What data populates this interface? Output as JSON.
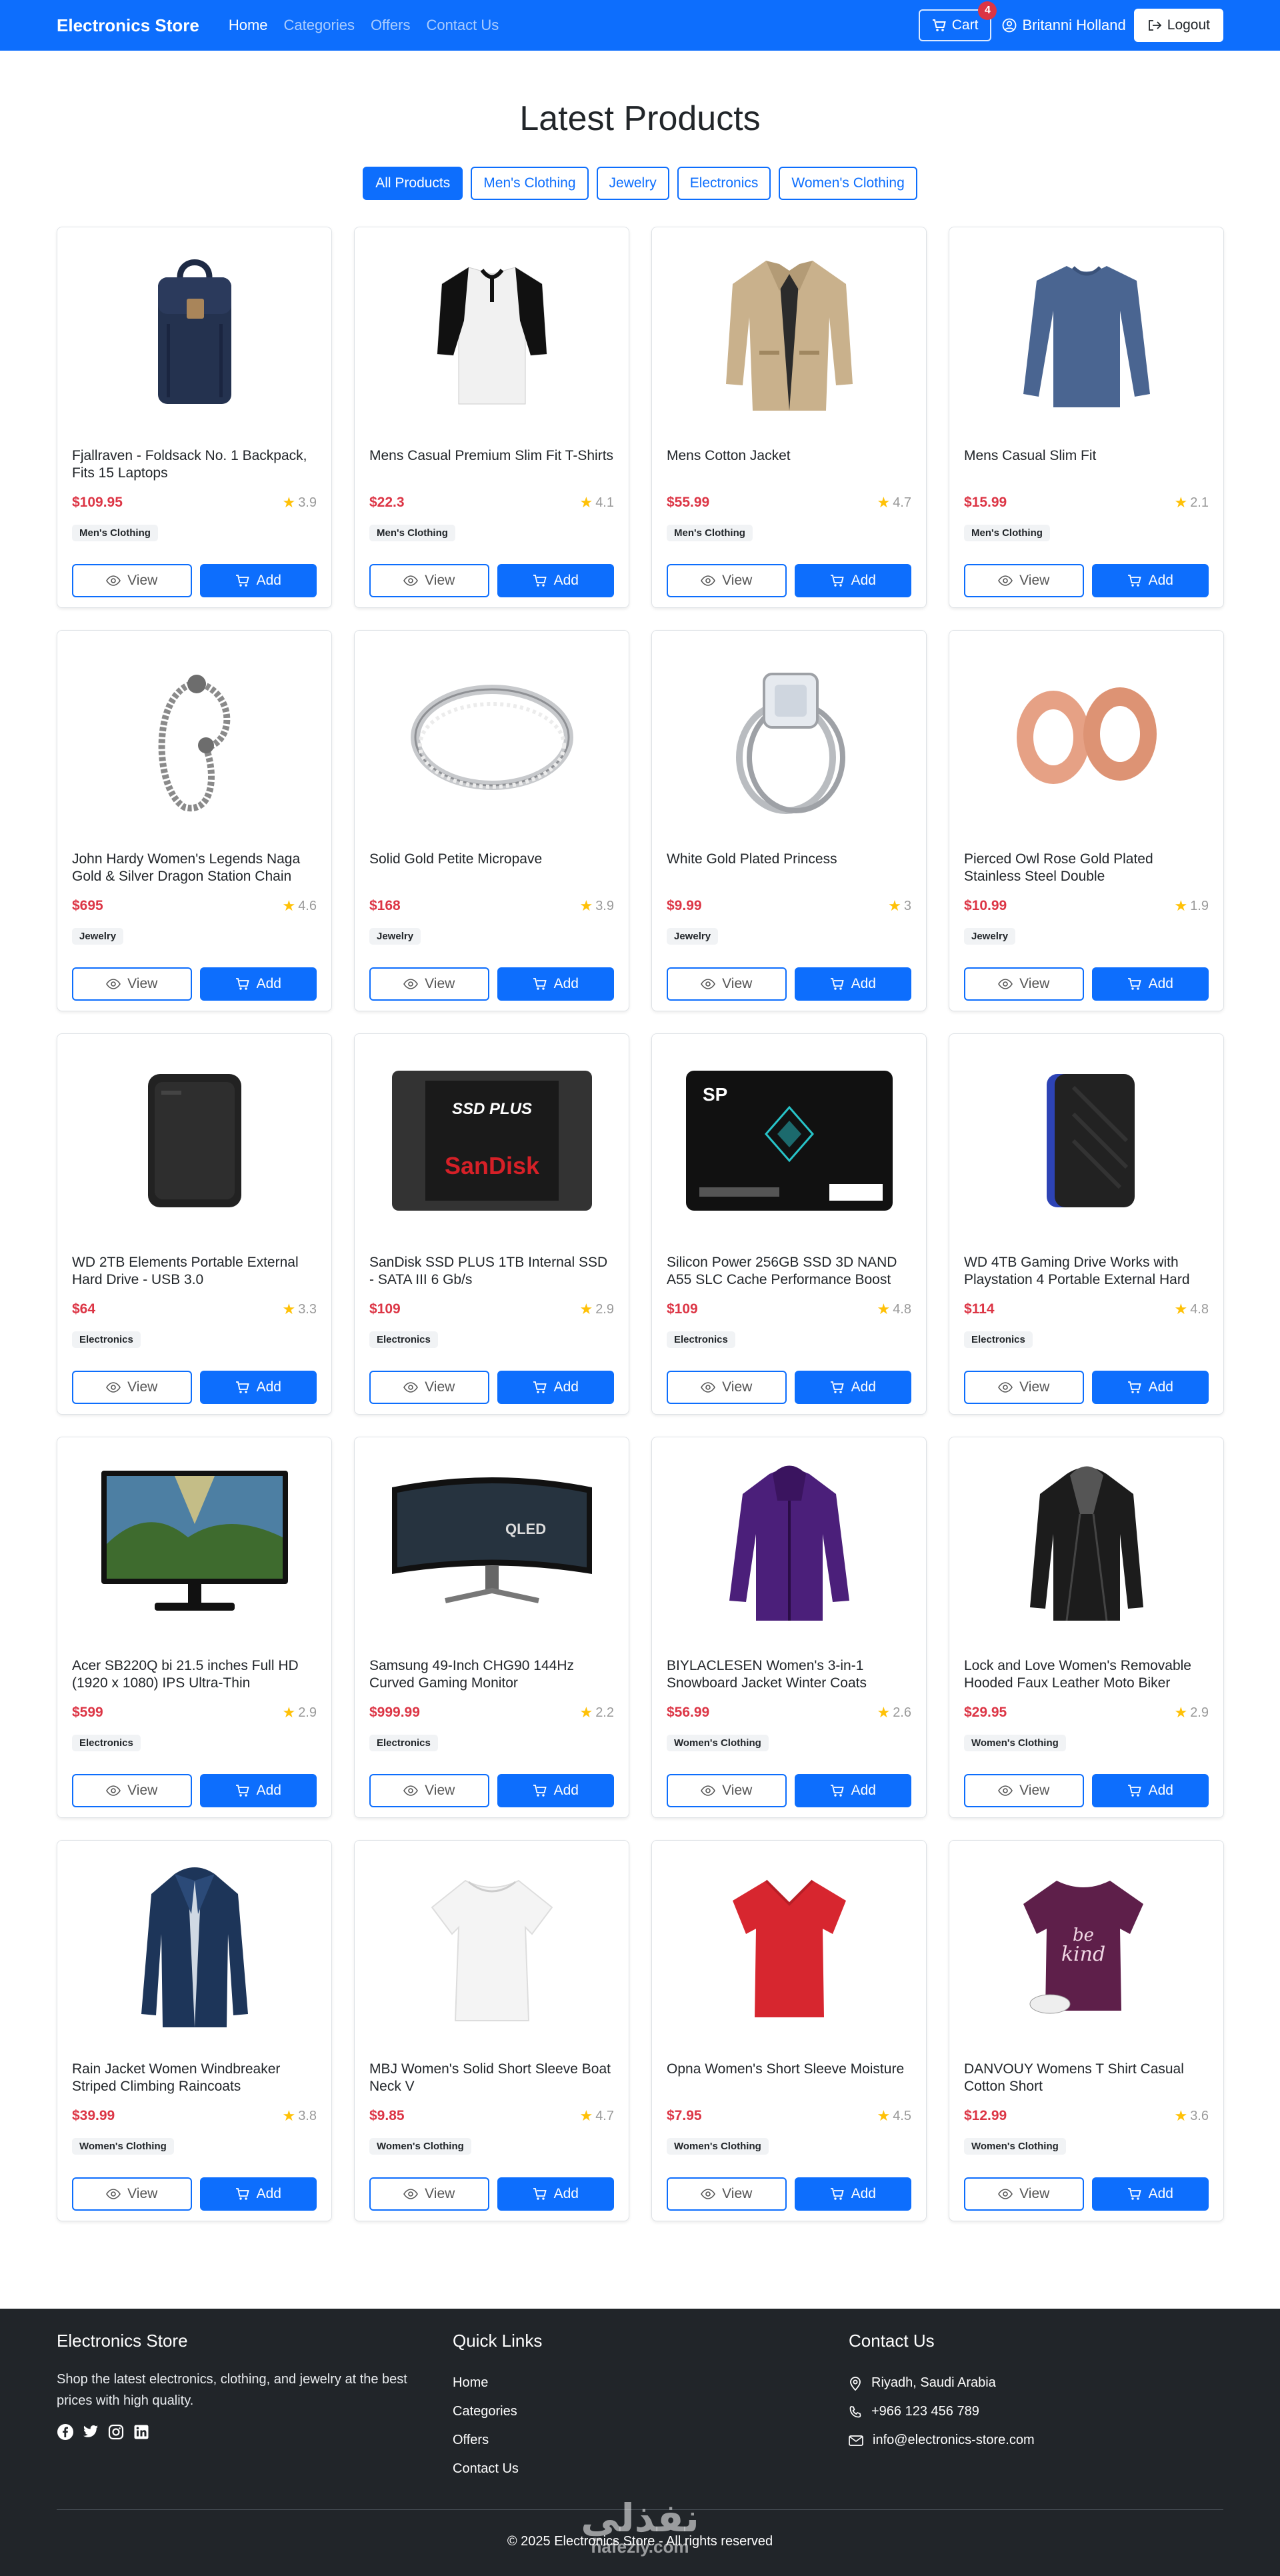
{
  "nav": {
    "brand": "Electronics Store",
    "links": [
      "Home",
      "Categories",
      "Offers",
      "Contact Us"
    ],
    "cart_label": "Cart",
    "cart_count": "4",
    "user_name": "Britanni Holland",
    "logout_label": "Logout"
  },
  "main": {
    "title": "Latest Products",
    "filters": [
      "All Products",
      "Men's Clothing",
      "Jewelry",
      "Electronics",
      "Women's Clothing"
    ],
    "view_label": "View",
    "add_label": "Add"
  },
  "products": [
    {
      "title": "Fjallraven - Foldsack No. 1 Backpack, Fits 15 Laptops",
      "price": "$109.95",
      "rating": "3.9",
      "category": "Men's Clothing",
      "icon": "backpack-icon"
    },
    {
      "title": "Mens Casual Premium Slim Fit T-Shirts",
      "price": "$22.3",
      "rating": "4.1",
      "category": "Men's Clothing",
      "icon": "tshirt-icon"
    },
    {
      "title": "Mens Cotton Jacket",
      "price": "$55.99",
      "rating": "4.7",
      "category": "Men's Clothing",
      "icon": "jacket-icon"
    },
    {
      "title": "Mens Casual Slim Fit",
      "price": "$15.99",
      "rating": "2.1",
      "category": "Men's Clothing",
      "icon": "longsleeve-icon"
    },
    {
      "title": "John Hardy Women's Legends Naga Gold & Silver Dragon Station Chain",
      "price": "$695",
      "rating": "4.6",
      "category": "Jewelry",
      "icon": "bracelet-icon"
    },
    {
      "title": "Solid Gold Petite Micropave",
      "price": "$168",
      "rating": "3.9",
      "category": "Jewelry",
      "icon": "ring-icon"
    },
    {
      "title": "White Gold Plated Princess",
      "price": "$9.99",
      "rating": "3",
      "category": "Jewelry",
      "icon": "diamond-ring-icon"
    },
    {
      "title": "Pierced Owl Rose Gold Plated Stainless Steel Double",
      "price": "$10.99",
      "rating": "1.9",
      "category": "Jewelry",
      "icon": "plugs-icon"
    },
    {
      "title": "WD 2TB Elements Portable External Hard Drive - USB 3.0",
      "price": "$64",
      "rating": "3.3",
      "category": "Electronics",
      "icon": "hard-drive-icon"
    },
    {
      "title": "SanDisk SSD PLUS 1TB Internal SSD - SATA III 6 Gb/s",
      "price": "$109",
      "rating": "2.9",
      "category": "Electronics",
      "icon": "sandisk-ssd-icon"
    },
    {
      "title": "Silicon Power 256GB SSD 3D NAND A55 SLC Cache Performance Boost",
      "price": "$109",
      "rating": "4.8",
      "category": "Electronics",
      "icon": "sp-ssd-icon"
    },
    {
      "title": "WD 4TB Gaming Drive Works with Playstation 4 Portable External Hard",
      "price": "$114",
      "rating": "4.8",
      "category": "Electronics",
      "icon": "gaming-drive-icon"
    },
    {
      "title": "Acer SB220Q bi 21.5 inches Full HD (1920 x 1080) IPS Ultra-Thin",
      "price": "$599",
      "rating": "2.9",
      "category": "Electronics",
      "icon": "monitor-icon"
    },
    {
      "title": "Samsung 49-Inch CHG90 144Hz Curved Gaming Monitor",
      "price": "$999.99",
      "rating": "2.2",
      "category": "Electronics",
      "icon": "curved-monitor-icon"
    },
    {
      "title": "BIYLACLESEN Women's 3-in-1 Snowboard Jacket Winter Coats",
      "price": "$56.99",
      "rating": "2.6",
      "category": "Women's Clothing",
      "icon": "purple-jacket-icon"
    },
    {
      "title": "Lock and Love Women's Removable Hooded Faux Leather Moto Biker",
      "price": "$29.95",
      "rating": "2.9",
      "category": "Women's Clothing",
      "icon": "leather-jacket-icon"
    },
    {
      "title": "Rain Jacket Women Windbreaker Striped Climbing Raincoats",
      "price": "$39.99",
      "rating": "3.8",
      "category": "Women's Clothing",
      "icon": "raincoat-icon"
    },
    {
      "title": "MBJ Women's Solid Short Sleeve Boat Neck V",
      "price": "$9.85",
      "rating": "4.7",
      "category": "Women's Clothing",
      "icon": "white-top-icon"
    },
    {
      "title": "Opna Women's Short Sleeve Moisture",
      "price": "$7.95",
      "rating": "4.5",
      "category": "Women's Clothing",
      "icon": "red-tshirt-icon"
    },
    {
      "title": "DANVOUY Womens T Shirt Casual Cotton Short",
      "price": "$12.99",
      "rating": "3.6",
      "category": "Women's Clothing",
      "icon": "purple-tshirt-icon"
    }
  ],
  "footer": {
    "about_title": "Electronics Store",
    "about_text": "Shop the latest electronics, clothing, and jewelry at the best prices with high quality.",
    "links_title": "Quick Links",
    "links": [
      "Home",
      "Categories",
      "Offers",
      "Contact Us"
    ],
    "contact_title": "Contact Us",
    "address": "Riyadh, Saudi Arabia",
    "phone": "+966 123 456 789",
    "email": "info@electronics-store.com",
    "copyright": "© 2025 Electronics Store - All rights reserved",
    "watermark_ar": "نفذلي",
    "watermark_en": "nafezly.com"
  },
  "colors": {
    "primary": "#0d6efd",
    "price": "#dc3545",
    "star": "#ffc107",
    "footer_bg": "#212529"
  }
}
